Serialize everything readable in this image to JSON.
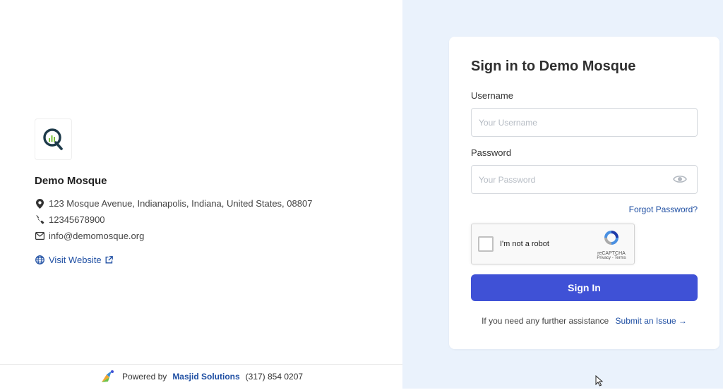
{
  "org": {
    "name": "Demo Mosque",
    "address": "123 Mosque Avenue, Indianapolis, Indiana, United States, 08807",
    "phone": "12345678900",
    "email": "info@demomosque.org",
    "website_label": "Visit Website"
  },
  "footer": {
    "powered_by": "Powered by",
    "brand": "Masjid Solutions",
    "phone": "(317) 854 0207"
  },
  "login": {
    "title": "Sign in to Demo Mosque",
    "username_label": "Username",
    "username_placeholder": "Your Username",
    "username_value": "",
    "password_label": "Password",
    "password_placeholder": "Your Password",
    "password_value": "",
    "forgot_label": "Forgot Password?",
    "captcha_text": "I'm not a robot",
    "captcha_brand": "reCAPTCHA",
    "captcha_links": "Privacy - Terms",
    "submit_label": "Sign In",
    "assist_text": "If you need any further assistance",
    "issue_link": "Submit an Issue →"
  },
  "colors": {
    "accent": "#3f51d6",
    "link": "#1f4fa3",
    "right_bg": "#eaf2fc"
  },
  "icons": {
    "logo": "mosque-q-logo",
    "address": "map-marker-icon",
    "phone": "phone-icon",
    "email": "envelope-icon",
    "website": "globe-icon",
    "external": "external-link-icon",
    "password_toggle": "eye-icon",
    "brand": "masjid-solutions-icon"
  }
}
